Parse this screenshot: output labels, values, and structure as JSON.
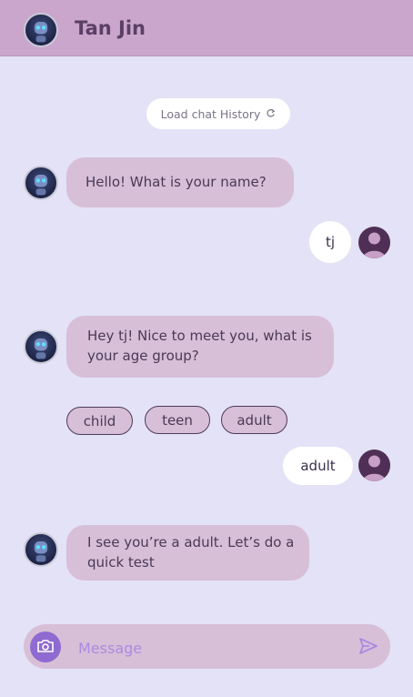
{
  "header": {
    "title": "Tan Jin",
    "avatar_icon": "robot-avatar-icon"
  },
  "history": {
    "label": "Load chat History",
    "icon": "refresh-icon"
  },
  "messages": [
    {
      "sender": "bot",
      "text": "Hello! What is your name?"
    },
    {
      "sender": "user",
      "text": "tj"
    },
    {
      "sender": "bot",
      "text": "Hey tj! Nice to meet you, what is your age group?"
    },
    {
      "sender": "user",
      "text": "adult"
    },
    {
      "sender": "bot",
      "text": "I see you’re a adult. Let’s do a quick test"
    }
  ],
  "options": [
    "child",
    "teen",
    "adult"
  ],
  "composer": {
    "placeholder": "Message",
    "camera_icon": "camera-icon",
    "send_icon": "send-icon"
  },
  "colors": {
    "header_bg": "#caa6cc",
    "page_bg": "#e4e2f6",
    "bot_bubble": "#d7bfd8",
    "accent": "#8f6ad0"
  }
}
